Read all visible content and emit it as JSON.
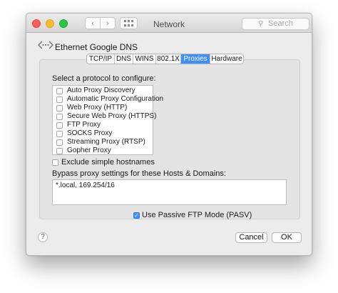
{
  "window": {
    "title": "Network",
    "search_placeholder": "Search",
    "back_icon": "‹",
    "forward_icon": "›",
    "search_icon": "⚲"
  },
  "service": {
    "name": "Ethernet Google DNS"
  },
  "tabs": [
    {
      "label": "TCP/IP",
      "active": false
    },
    {
      "label": "DNS",
      "active": false
    },
    {
      "label": "WINS",
      "active": false
    },
    {
      "label": "802.1X",
      "active": false
    },
    {
      "label": "Proxies",
      "active": true
    },
    {
      "label": "Hardware",
      "active": false
    }
  ],
  "proxies": {
    "select_label": "Select a protocol to configure:",
    "protocols": [
      {
        "label": "Auto Proxy Discovery",
        "checked": false
      },
      {
        "label": "Automatic Proxy Configuration",
        "checked": false
      },
      {
        "label": "Web Proxy (HTTP)",
        "checked": false
      },
      {
        "label": "Secure Web Proxy (HTTPS)",
        "checked": false
      },
      {
        "label": "FTP Proxy",
        "checked": false
      },
      {
        "label": "SOCKS Proxy",
        "checked": false
      },
      {
        "label": "Streaming Proxy (RTSP)",
        "checked": false
      },
      {
        "label": "Gopher Proxy",
        "checked": false
      }
    ],
    "exclude_simple_label": "Exclude simple hostnames",
    "exclude_simple_checked": false,
    "bypass_label": "Bypass proxy settings for these Hosts & Domains:",
    "bypass_value": "*.local, 169.254/16",
    "passive_ftp_label": "Use Passive FTP Mode (PASV)",
    "passive_ftp_checked": true
  },
  "footer": {
    "help_label": "?",
    "cancel_label": "Cancel",
    "ok_label": "OK"
  },
  "colors": {
    "accent": "#3f8ff5",
    "close": "#fc5f57",
    "minimize": "#fdbc2e",
    "maximize": "#28c840"
  }
}
